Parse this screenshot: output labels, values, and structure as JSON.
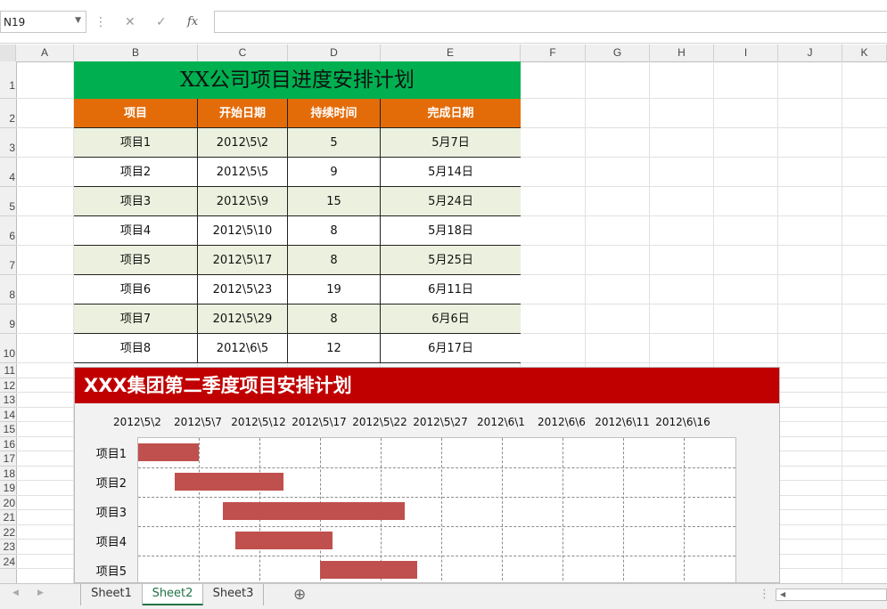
{
  "formula_bar": {
    "name_box": "N19",
    "cancel_icon": "✕",
    "enter_icon": "✓",
    "fx_label": "fx",
    "formula": ""
  },
  "columns": [
    "A",
    "B",
    "C",
    "D",
    "E",
    "F",
    "G",
    "H",
    "I",
    "J",
    "K"
  ],
  "rows": [
    "1",
    "2",
    "3",
    "4",
    "5",
    "6",
    "7",
    "8",
    "9",
    "10",
    "11",
    "12",
    "13",
    "14",
    "15",
    "16",
    "17",
    "18",
    "19",
    "20",
    "21",
    "22",
    "23",
    "24"
  ],
  "table": {
    "title": "XX公司项目进度安排计划",
    "headers": [
      "项目",
      "开始日期",
      "持续时间",
      "完成日期"
    ],
    "rows": [
      [
        "项目1",
        "2012\\5\\2",
        "5",
        "5月7日"
      ],
      [
        "项目2",
        "2012\\5\\5",
        "9",
        "5月14日"
      ],
      [
        "项目3",
        "2012\\5\\9",
        "15",
        "5月24日"
      ],
      [
        "项目4",
        "2012\\5\\10",
        "8",
        "5月18日"
      ],
      [
        "项目5",
        "2012\\5\\17",
        "8",
        "5月25日"
      ],
      [
        "项目6",
        "2012\\5\\23",
        "19",
        "6月11日"
      ],
      [
        "项目7",
        "2012\\5\\29",
        "8",
        "6月6日"
      ],
      [
        "项目8",
        "2012\\6\\5",
        "12",
        "6月17日"
      ]
    ],
    "colors": {
      "title_bg": "#00b050",
      "header_bg": "#e36c09",
      "band": "#ebf1de"
    }
  },
  "chart_data": {
    "type": "bar",
    "title": "XXX集团第二季度项目安排计划",
    "orientation": "horizontal-gantt",
    "x_ticks": [
      "2012\\5\\2",
      "2012\\5\\7",
      "2012\\5\\12",
      "2012\\5\\17",
      "2012\\5\\22",
      "2012\\5\\27",
      "2012\\6\\1",
      "2012\\6\\6",
      "2012\\6\\11",
      "2012\\6\\16"
    ],
    "xlim": [
      "2012-05-02",
      "2012-06-21"
    ],
    "categories": [
      "项目1",
      "项目2",
      "项目3",
      "项目4",
      "项目5"
    ],
    "series": [
      {
        "start": [
          "2012-05-02",
          "2012-05-05",
          "2012-05-09",
          "2012-05-10",
          "2012-05-17"
        ],
        "duration": [
          5,
          9,
          15,
          8,
          8
        ]
      }
    ],
    "bar_color": "#c0504d",
    "grid": true,
    "colors": {
      "title_bg": "#c00000",
      "plot_bg": "#ffffff",
      "chart_bg": "#f2f2f2"
    }
  },
  "sheets": {
    "tabs": [
      "Sheet1",
      "Sheet2",
      "Sheet3"
    ],
    "active": "Sheet2",
    "add_icon": "⊕",
    "prev_icon": "◀",
    "next_icon": "▶",
    "more_icon": "⋮"
  }
}
